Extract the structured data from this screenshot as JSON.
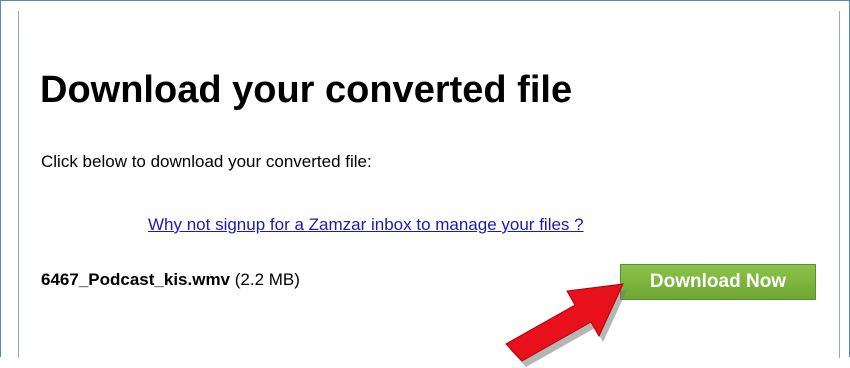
{
  "page": {
    "title": "Download your converted file",
    "instruction": "Click below to download your converted file:",
    "signup_link": "Why not signup for a Zamzar inbox to manage your files ?"
  },
  "file": {
    "name": "6467_Podcast_kis.wmv",
    "size": "(2.2 MB)"
  },
  "download_button": {
    "label": "Download Now"
  },
  "colors": {
    "link": "#1a1ab8",
    "button_green": "#7ab33c",
    "arrow_red": "#e8101a",
    "frame_border": "#5b86c5"
  },
  "icons": {
    "annotation": "red-arrow-icon"
  }
}
